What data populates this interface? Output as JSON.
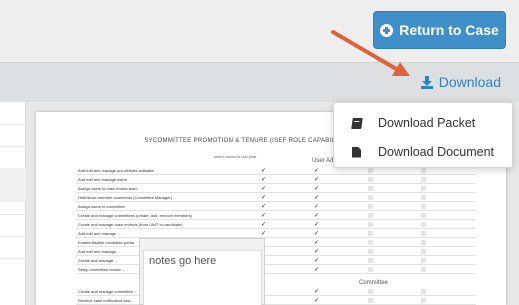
{
  "header": {
    "return_label": "Return to Case"
  },
  "toolbar": {
    "download_label": "Download"
  },
  "menu": {
    "items": [
      {
        "label": "Download Packet",
        "icon": "book-icon"
      },
      {
        "label": "Download Document",
        "icon": "file-icon"
      }
    ]
  },
  "document": {
    "title": "SYCOMMITTEE PROMOTION & TENURE (ISEF ROLE CAPABILITY)",
    "subtitle": "select below    in last year",
    "yes_label": "User A/B",
    "section_label": "Committee",
    "rows": [
      "Add edit and manage pre-defined available",
      "Add edit and manage users",
      "Assign users to case review team",
      "Hide/show member comments (Committee Manager)",
      "Assign users to committee",
      "Create and manage committees (create, add, remove members)",
      "Create and manage case reviews (from UNIT to candidate)",
      "Add edit and manage ...",
      "Enable/disable candidate portal",
      "Add edit and manage ...",
      "Create and manage ...",
      "Setup committee review ..."
    ],
    "lower_rows": [
      "Create and manage committee ...",
      "Receive case notification and ..."
    ]
  },
  "notes": {
    "placeholder": "notes go here"
  },
  "colors": {
    "primary_button": "#3f8fc8",
    "link": "#2e83c1",
    "annotation_arrow": "#e0623a"
  }
}
